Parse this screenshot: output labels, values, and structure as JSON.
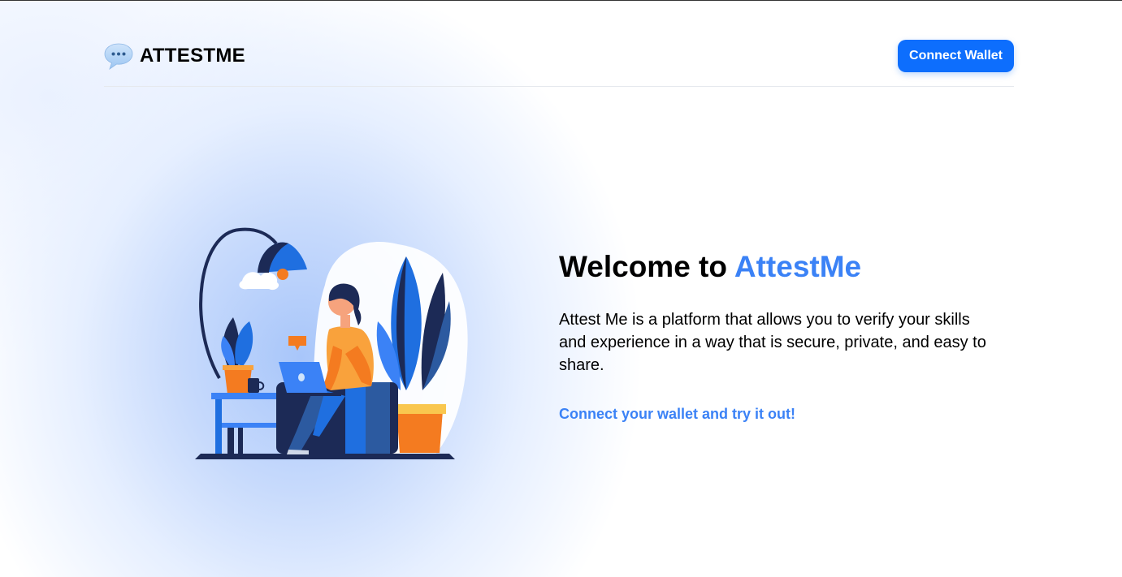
{
  "header": {
    "brand_name": "ATTESTME",
    "brand_icon": "speech-bubble-icon",
    "connect_wallet_label": "Connect Wallet"
  },
  "hero": {
    "title_prefix": "Welcome to",
    "title_accent": "AttestMe",
    "description": "Attest Me is a platform that allows you to verify your skills and experience in a way that is secure, private, and easy to share.",
    "cta_label": "Connect your wallet and try it out!"
  },
  "illustration": {
    "subject": "person-working-on-laptop-illustration"
  },
  "colors": {
    "primary": "#0d6efd",
    "accent": "#3b82f6",
    "orange": "#f47b20",
    "navy": "#1c2a56"
  }
}
